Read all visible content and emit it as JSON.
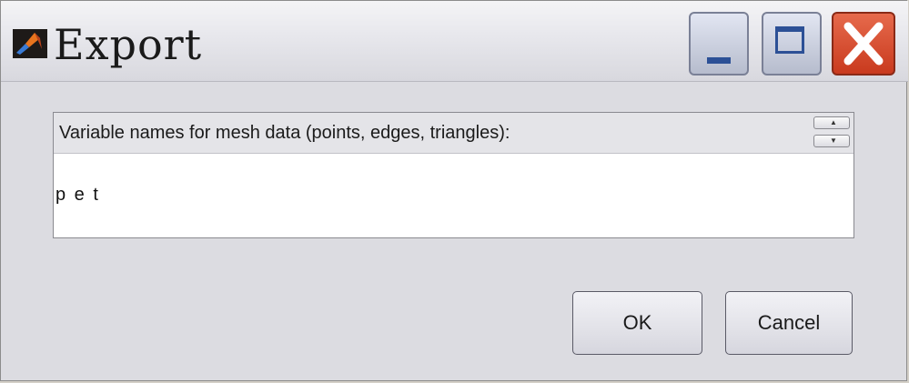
{
  "window": {
    "title": "Export",
    "icon": "matlab-logo-icon",
    "controls": {
      "minimize": "minimize-icon",
      "maximize": "maximize-icon",
      "close": "close-icon"
    }
  },
  "panel": {
    "label": "Variable names for mesh data (points, edges, triangles):",
    "value": "p e t",
    "spinner": [
      "spin-up-icon",
      "spin-down-icon"
    ]
  },
  "buttons": {
    "ok": "OK",
    "cancel": "Cancel"
  },
  "colors": {
    "close_button": "#d9482c",
    "window_button_glyph": "#2c5096"
  }
}
